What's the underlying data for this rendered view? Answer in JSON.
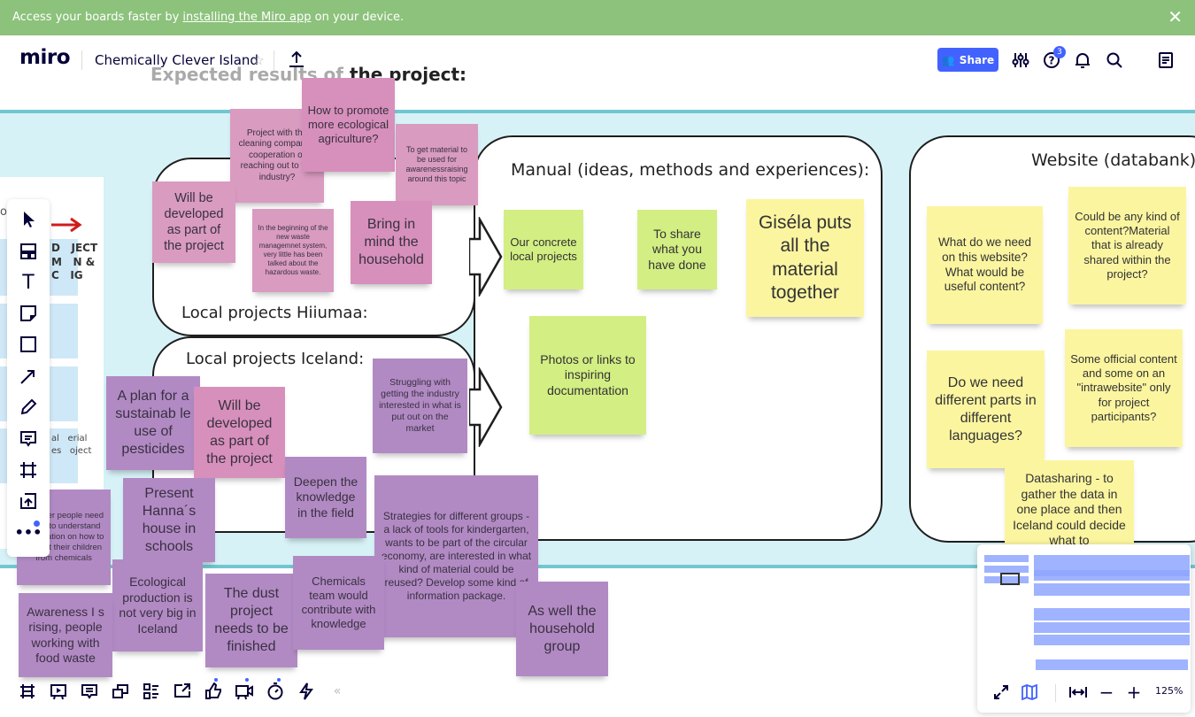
{
  "banner": {
    "prefix": "Access your boards faster by ",
    "link": "installing the Miro app",
    "suffix": " on your device."
  },
  "header": {
    "logo": "miro",
    "board_title": "Chemically Clever Island",
    "share_label": "Share",
    "help_badge": "3"
  },
  "board": {
    "heading_faded": "Expected results of ",
    "heading_bold": "the project:",
    "hiiumaa_label": "Local projects Hiiumaa:",
    "iceland_label": "Local projects Iceland:",
    "manual_label": "Manual (ideas, methods and experiences):",
    "website_label": "Website (databank):",
    "notes": [
      "Project with the cleaning company - cooperation or reaching out to the industry?",
      "How to promote more ecological agriculture?",
      "To get material to be used for awarenessraising around this topic",
      "Will be developed as part of the project",
      "In the beginning of the new waste managemnet system, very little has been talked about the hazardous waste.",
      "Bring in mind the household",
      "Our concrete local projects",
      "To share what you have done",
      "Photos or links to inspiring documentation",
      "Giséla puts all the material together",
      "What do we need on this website? What would be useful content?",
      "Could be any kind of content?Material that is already shared within the project?",
      "Do we need different parts in different languages?",
      "Some official content and some on an \"intrawebsite\" only for project participants?",
      "Datasharing - to gather the data in one place and then Iceland could decide what to",
      "Struggling with getting the industry interested in what is put out on the market",
      "A plan for a sustainab le use of pesticides",
      "Will be developed as part of the project",
      "Present Hanna´s house in schools",
      "Deepen the knowledge in the field",
      "Strategies for different groups - a lack of tools for kindergarten, wants to be part of the circular economy, are interested in what kind of material could be reused? Develop some kind of information package.",
      "Younger people need leasy to understand information on how to protect their children from chemicals",
      "Ecological production is not very big in Iceland",
      "The dust project needs to be finished",
      "Chemicals team would contribute with knowledge",
      "As well the household group",
      "Awareness I s rising, people working with food waste"
    ],
    "left_panel": {
      "title_fragment": "o         t",
      "cell1": "D   JECT\nM   N &\nC   IG",
      "cell4": "al   erial\nes   oject"
    }
  },
  "toolbar": [
    "select",
    "templates",
    "text",
    "sticky-note",
    "shape",
    "connection-line",
    "pen",
    "comment",
    "frame",
    "upload",
    "more"
  ],
  "bottom_toolbar": [
    "frames",
    "presentation",
    "comments",
    "cards",
    "kanban",
    "share-screen",
    "voting",
    "video",
    "timer",
    "lightning"
  ],
  "minimap": {
    "zoom": "125%"
  },
  "colors": {
    "accent": "#4262ff",
    "banner": "#8cc27b",
    "pink_note": "#d99bc0",
    "purple_note": "#b18ac4",
    "green_note": "#d3ee83",
    "yellow_note": "#fbf5a0",
    "band": "#d6f2f6"
  }
}
